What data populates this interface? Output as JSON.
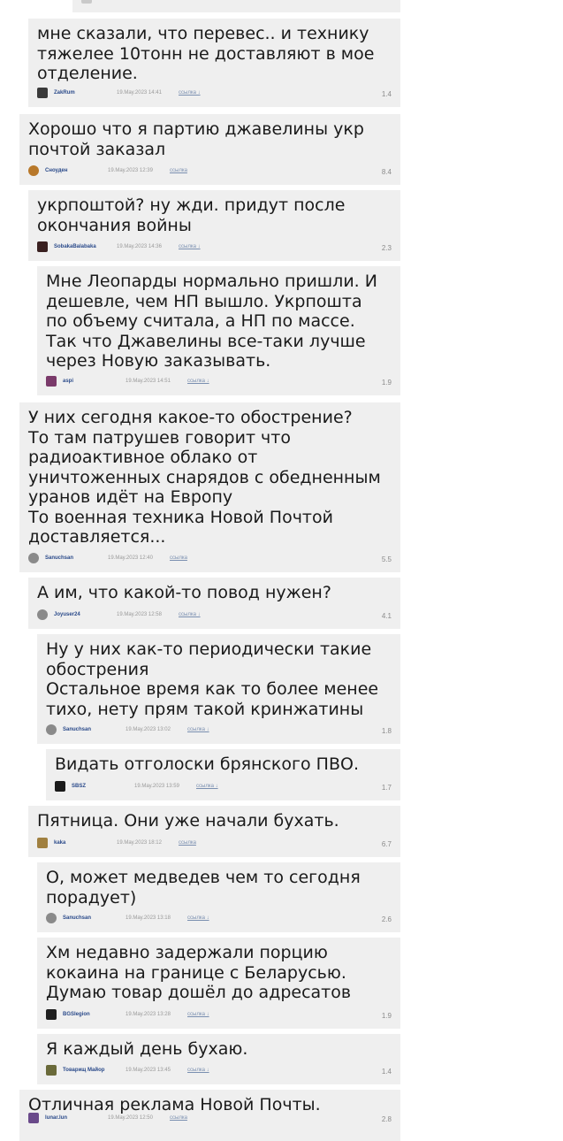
{
  "comments": [
    {
      "text": "",
      "author": "",
      "date": "",
      "link": "",
      "rating": "",
      "color": "#c9c9c9"
    },
    {
      "text": "мне сказали, что перевес.. и технику\nтяжелее 10тонн не доставляют в мое\nотделение.",
      "author": "ZakRum",
      "date": "19.May.2023 14:41",
      "link": "ссылка ↓",
      "rating": "1.4",
      "color": "#3a3a3a"
    },
    {
      "text": "Хорошо что я партию джавелины укр\nпочтой заказал",
      "author": "Сноуден",
      "date": "19.May.2023 12:39",
      "link": "ссылка",
      "rating": "8.4",
      "color": "#b8782a"
    },
    {
      "text": "укрпоштой? ну жди. придут после\nокончания войны",
      "author": "SobakaBalabaka",
      "date": "19.May.2023 14:36",
      "link": "ссылка ↓",
      "rating": "2.3",
      "color": "#3a2020"
    },
    {
      "text": "Мне Леопарды нормально пришли. И\nдешевле, чем НП вышло. Укрпошта\nпо объему считала, а НП по массе.\nТак что Джавелины все-таки лучше\nчерез Новую заказывать.",
      "author": "aspi",
      "date": "19.May.2023 14:51",
      "link": "ссылка ↓",
      "rating": "1.9",
      "color": "#7a3a6a"
    },
    {
      "text": "У них сегодня какое-то обострение?\nТо там патрушев говорит что\nрадиоактивное облако от\nуничтоженных снарядов с обедненным\nуранов идёт на Европу\nТо военная техника Новой Почтой\nдоставляется...",
      "author": "Sanuchsan",
      "date": "19.May.2023 12:40",
      "link": "ссылка",
      "rating": "5.5",
      "color": "#8a8a8a"
    },
    {
      "text": "А им, что какой-то повод нужен?",
      "author": "Joyuser24",
      "date": "19.May.2023 12:58",
      "link": "ссылка ↓",
      "rating": "4.1",
      "color": "#8a8a8a"
    },
    {
      "text": "Ну у них как-то периодически такие\nобострения\nОстальное время как то более менее\nтихо, нету прям такой кринжатины",
      "author": "Sanuchsan",
      "date": "19.May.2023 13:02",
      "link": "ссылка ↓",
      "rating": "1.8",
      "color": "#8a8a8a"
    },
    {
      "text": "Видать отголоски брянского ПВО.",
      "author": "SBSZ",
      "date": "19.May.2023 13:59",
      "link": "ссылка ↓",
      "rating": "1.7",
      "color": "#1a1a1a"
    },
    {
      "text": "Пятница. Они уже начали бухать.",
      "author": "kaka",
      "date": "19.May.2023 18:12",
      "link": "ссылка",
      "rating": "6.7",
      "color": "#a08040"
    },
    {
      "text": "О, может медведев чем то сегодня\nпорадует)",
      "author": "Sanuchsan",
      "date": "19.May.2023 13:18",
      "link": "ссылка ↓",
      "rating": "2.6",
      "color": "#8a8a8a"
    },
    {
      "text": "Хм недавно задержали порцию\nкокаина на границе с Беларусью.\nДумаю товар дошёл до адресатов",
      "author": "BGSlegion",
      "date": "19.May.2023 13:28",
      "link": "ссылка ↓",
      "rating": "1.9",
      "color": "#202020"
    },
    {
      "text": "Я каждый день бухаю.",
      "author": "Товарищ Майор",
      "date": "19.May.2023 13:45",
      "link": "ссылка ↓",
      "rating": "1.4",
      "color": "#6a6a3a"
    },
    {
      "text": "Отличная реклама Новой Почты.",
      "author": "lunar.lun",
      "date": "19.May.2023 12:50",
      "link": "ссылка",
      "rating": "2.8",
      "color": "#6a4a8a"
    }
  ]
}
